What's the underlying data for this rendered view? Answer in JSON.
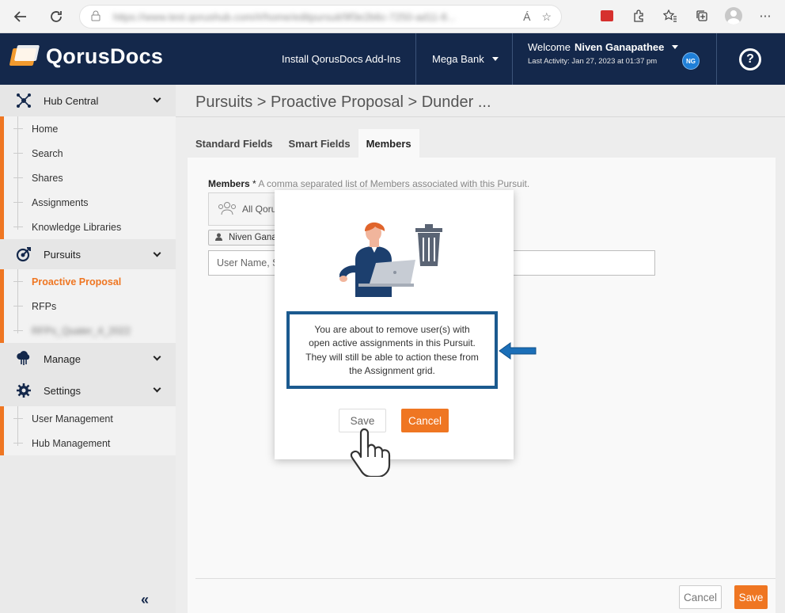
{
  "browser": {
    "url": "https://www.test.qorushub.com/#/home/editpursuit/9f3e2b6c-7250-ad11-8...",
    "reader_label": "Á",
    "menu_label": "⋯"
  },
  "header": {
    "logo_text": "QorusDocs",
    "install_label": "Install QorusDocs Add-Ins",
    "bank_label": "Mega Bank",
    "welcome_label": "Welcome",
    "user_name": "Niven Ganapathee",
    "last_activity": "Last Activity: Jan 27, 2023 at 01:37 pm",
    "user_initials": "NG",
    "help_label": "?"
  },
  "sidebar": {
    "sections": [
      {
        "label": "Hub Central",
        "icon": "hub-icon",
        "items": [
          "Home",
          "Search",
          "Shares",
          "Assignments",
          "Knowledge Libraries"
        ]
      },
      {
        "label": "Pursuits",
        "icon": "target-icon",
        "items": [
          "Proactive Proposal",
          "RFPs",
          "RFPs_Quater_4_2022"
        ]
      },
      {
        "label": "Manage",
        "icon": "cloud-icon",
        "items": []
      },
      {
        "label": "Settings",
        "icon": "gear-icon",
        "items": [
          "User Management",
          "Hub Management"
        ]
      }
    ],
    "collapse_label": "«"
  },
  "main": {
    "breadcrumb": "Pursuits > Proactive Proposal > Dunder ...",
    "tabs": [
      "Standard Fields",
      "Smart Fields",
      "Members"
    ],
    "members_label": "Members",
    "members_required": "*",
    "members_hint": "A comma separated list of Members associated with this Pursuit.",
    "picker_text": "All Qoru",
    "chip_text": "Niven Gana",
    "user_input_placeholder": "User Name, S",
    "cancel_label": "Cancel",
    "save_label": "Save"
  },
  "modal": {
    "message": "You are about to remove user(s) with open active assignments in this Pursuit. They will still be able to action these from the Assignment grid.",
    "save_label": "Save",
    "cancel_label": "Cancel"
  },
  "colors": {
    "navy": "#14284b",
    "orange": "#ef7622",
    "callout_blue": "#1b5a8f"
  }
}
